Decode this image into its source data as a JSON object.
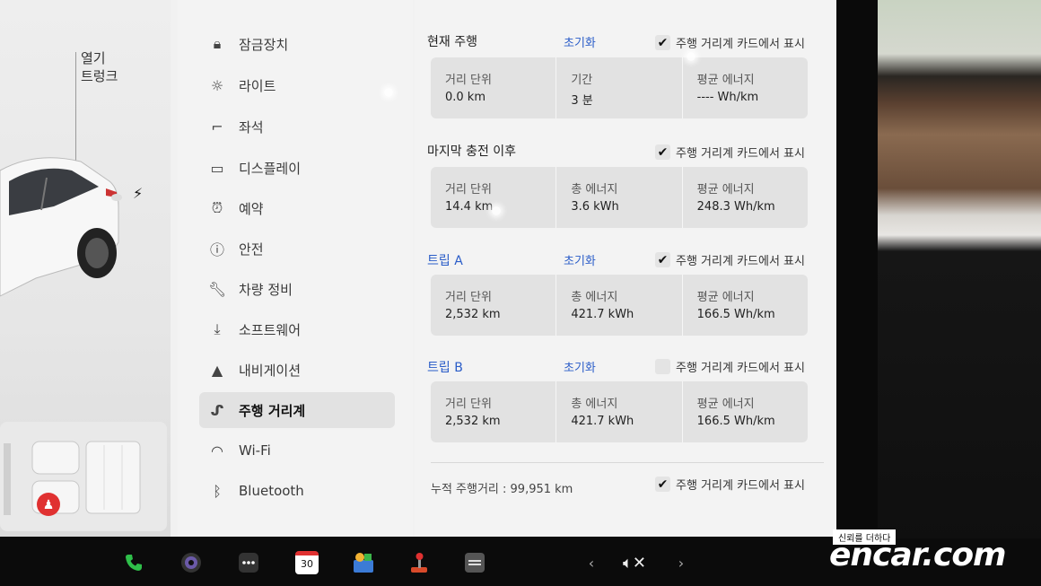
{
  "vehicle": {
    "trunk_action": "열기",
    "trunk_label": "트렁크"
  },
  "menu": {
    "items": [
      {
        "label": "잠금장치",
        "icon": "lock-icon"
      },
      {
        "label": "라이트",
        "icon": "light-icon"
      },
      {
        "label": "좌석",
        "icon": "seat-icon"
      },
      {
        "label": "디스플레이",
        "icon": "display-icon"
      },
      {
        "label": "예약",
        "icon": "alarm-icon"
      },
      {
        "label": "안전",
        "icon": "safety-icon"
      },
      {
        "label": "차량 정비",
        "icon": "wrench-icon"
      },
      {
        "label": "소프트웨어",
        "icon": "download-icon"
      },
      {
        "label": "내비게이션",
        "icon": "navigation-icon"
      },
      {
        "label": "주행 거리계",
        "icon": "trip-icon",
        "active": true
      },
      {
        "label": "Wi-Fi",
        "icon": "wifi-icon"
      },
      {
        "label": "Bluetooth",
        "icon": "bluetooth-icon"
      }
    ]
  },
  "trips": {
    "checkbox_label": "주행 거리계 카드에서 표시",
    "reset_label": "초기화",
    "current": {
      "title": "현재 주행",
      "checked": true,
      "cells": [
        {
          "label": "거리 단위",
          "value": "0.0 km"
        },
        {
          "label": "기간",
          "value": "3 분"
        },
        {
          "label": "평균 에너지",
          "value": "---- Wh/km"
        }
      ]
    },
    "since_charge": {
      "title": "마지막 충전 이후",
      "checked": true,
      "cells": [
        {
          "label": "거리 단위",
          "value": "14.4 km"
        },
        {
          "label": "총 에너지",
          "value": "3.6 kWh"
        },
        {
          "label": "평균 에너지",
          "value": "248.3 Wh/km"
        }
      ]
    },
    "trip_a": {
      "title": "트립 A",
      "checked": true,
      "cells": [
        {
          "label": "거리 단위",
          "value": "2,532 km"
        },
        {
          "label": "총 에너지",
          "value": "421.7 kWh"
        },
        {
          "label": "평균 에너지",
          "value": "166.5 Wh/km"
        }
      ]
    },
    "trip_b": {
      "title": "트립 B",
      "checked": false,
      "cells": [
        {
          "label": "거리 단위",
          "value": "2,532 km"
        },
        {
          "label": "총 에너지",
          "value": "421.7 kWh"
        },
        {
          "label": "평균 에너지",
          "value": "166.5 Wh/km"
        }
      ]
    },
    "odometer": "누적 주행거리 : 99,951 km",
    "odometer_checked": true
  },
  "taskbar": {
    "calendar_day": "30",
    "icons": [
      "phone-icon",
      "camera-icon",
      "more-icon",
      "calendar-icon",
      "toybox-icon",
      "arcade-icon",
      "dashcam-icon",
      "chevron-left-icon",
      "volume-mute-icon",
      "chevron-right-icon"
    ]
  },
  "watermark": {
    "tagline": "신뢰를 더하다",
    "brand": "encar.com"
  },
  "colors": {
    "accent": "#2a5cc8",
    "phone": "#2fbf4a",
    "seat_alert": "#e03131"
  }
}
